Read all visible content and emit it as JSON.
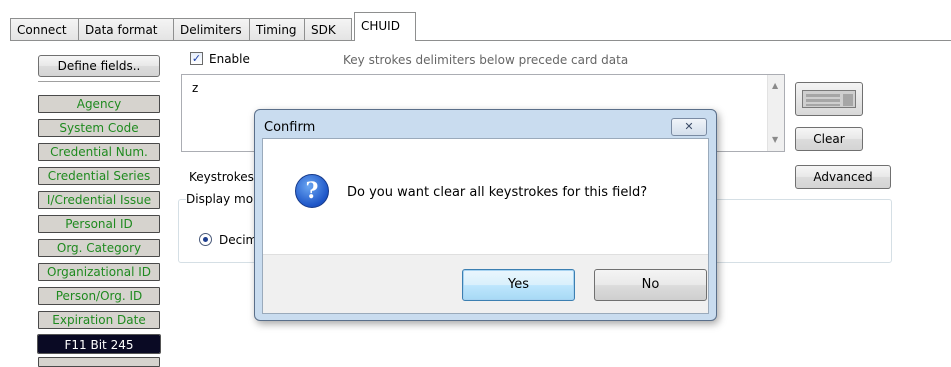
{
  "tabs": [
    {
      "label": "Connect"
    },
    {
      "label": "Data format"
    },
    {
      "label": "Delimiters"
    },
    {
      "label": "Timing"
    },
    {
      "label": "SDK"
    },
    {
      "label": "CHUID"
    }
  ],
  "left": {
    "define_fields_label": "Define fields..",
    "fields": [
      "Agency",
      "System Code",
      "Credential Num.",
      "Credential Series",
      "I/Credential Issue",
      "Personal ID",
      "Org. Category",
      "Organizational ID",
      "Person/Org. ID",
      "Expiration Date",
      "F11 Bit 245"
    ]
  },
  "main": {
    "enable_label": "Enable",
    "enable_checked": true,
    "hint": "Key strokes delimiters below precede card data",
    "keystrokes_value": "z",
    "clear_label": "Clear",
    "advanced_label": "Advanced",
    "keystrokes_label": "Keystrokes",
    "display_mode_label": "Display mo",
    "decimal_label": "Decim"
  },
  "dialog": {
    "title": "Confirm",
    "close_glyph": "✕",
    "icon": "question-icon",
    "message": "Do you want clear all keystrokes for this field?",
    "yes_label": "Yes",
    "no_label": "No"
  },
  "colors": {
    "field_text": "#1f8a1f",
    "field_bg": "#d6d3ce",
    "selected_field_bg": "#0a0a24",
    "dialog_frame": "#c9dcef"
  }
}
